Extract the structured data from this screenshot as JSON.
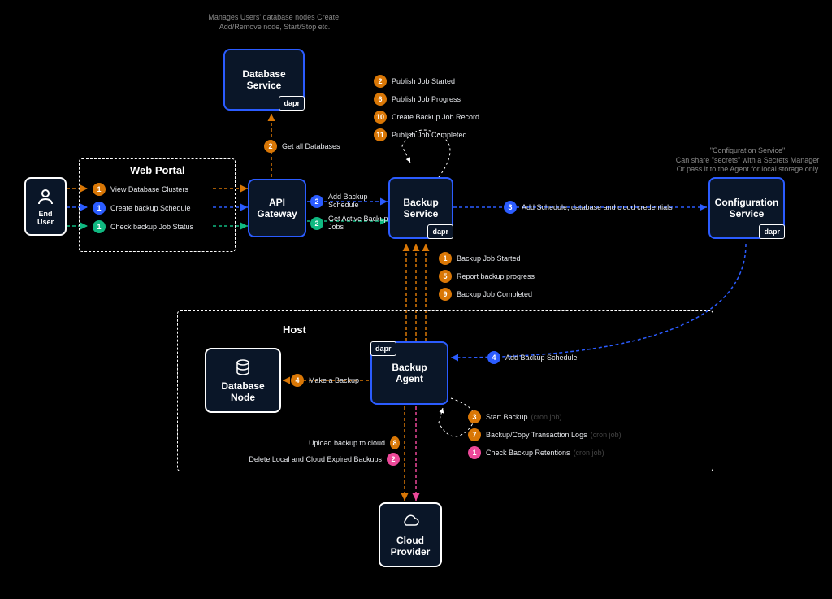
{
  "nodes": {
    "end_user": "End User",
    "api_gateway": "API\nGateway",
    "database_service": "Database\nService",
    "backup_service": "Backup\nService",
    "config_service": "Configuration\nService",
    "backup_agent": "Backup\nAgent",
    "database_node": "Database\nNode",
    "cloud_provider": "Cloud\nProvider"
  },
  "containers": {
    "web_portal": "Web Portal",
    "host": "Host"
  },
  "dapr": "dapr",
  "annotations": {
    "db_service": "Manages Users' database nodes\nCreate, Add/Remove node,\nStart/Stop etc.",
    "config": "\"Configuration Service\"\nCan share \"secrets\" with a Secrets Manager\nOr pass it to the Agent for local storage only"
  },
  "portal_actions": {
    "view": {
      "num": "1",
      "text": "View Database Clusters"
    },
    "create": {
      "num": "1",
      "text": "Create backup Schedule"
    },
    "check": {
      "num": "1",
      "text": "Check backup Job Status"
    }
  },
  "gateway_labels": {
    "get_db": {
      "num": "2",
      "text": "Get all Databases"
    },
    "add_schedule": {
      "num": "2",
      "text": "Add Backup\nSchedule"
    },
    "get_jobs": {
      "num": "2",
      "text": "Get Active Backup\nJobs"
    }
  },
  "svc_to_config": {
    "num": "3",
    "text": "Add Schedule, database and cloud credentials"
  },
  "config_to_agent": {
    "num": "4",
    "text": "Add Backup Schedule"
  },
  "agent_to_node": {
    "num": "4",
    "text": "Make a Backup"
  },
  "agent_internal": [
    {
      "num": "3",
      "text": "Start Backup",
      "faint": "(cron job)",
      "color": "orange"
    },
    {
      "num": "7",
      "text": "Backup/Copy Transaction Logs",
      "faint": "(cron job)",
      "color": "orange"
    },
    {
      "num": "1",
      "text": "Check Backup Retentions",
      "faint": "(cron job)",
      "color": "pink"
    }
  ],
  "agent_to_cloud": {
    "upload": {
      "num": "8",
      "text": "Upload backup to cloud"
    },
    "delete": {
      "num": "2",
      "text": "Delete Local and Cloud Expired Backups"
    }
  },
  "agent_to_svc": [
    {
      "num": "1",
      "text": "Backup Job Started"
    },
    {
      "num": "5",
      "text": "Report backup progress"
    },
    {
      "num": "9",
      "text": "Backup Job Completed"
    }
  ],
  "svc_internal": [
    {
      "num": "2",
      "text": "Publish Job Started"
    },
    {
      "num": "6",
      "text": "Publish Job Progress"
    },
    {
      "num": "10",
      "text": "Create Backup Job Record"
    },
    {
      "num": "11",
      "text": "Publish Job Completed"
    }
  ]
}
